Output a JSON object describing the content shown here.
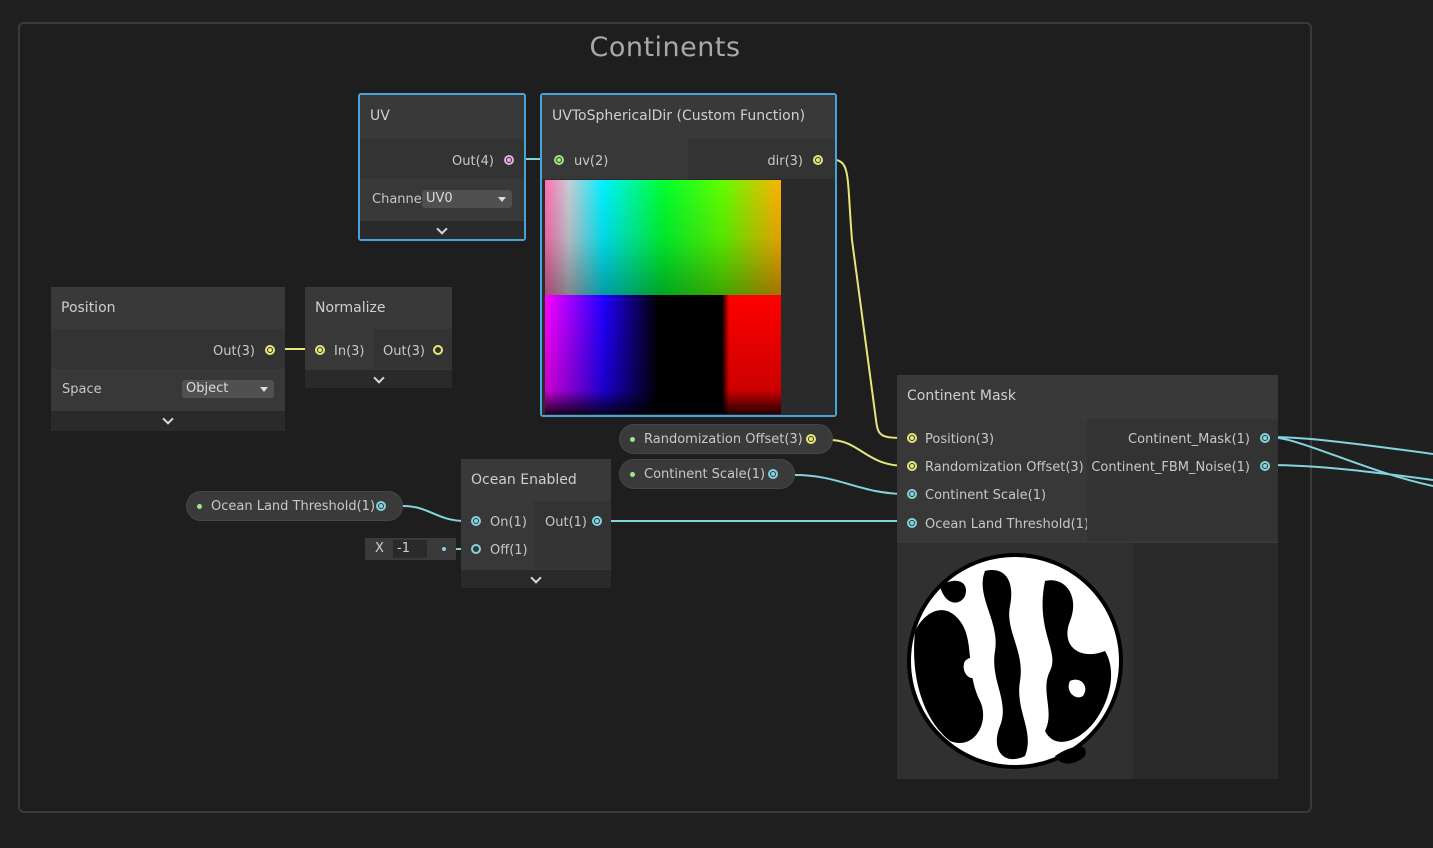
{
  "group": {
    "title": "Continents"
  },
  "nodes": {
    "uv": {
      "title": "UV",
      "out_label": "Out(4)",
      "channel_label": "Channe",
      "channel_value": "UV0"
    },
    "uv_to_spherical": {
      "title": "UVToSphericalDir (Custom Function)",
      "in_label": "uv(2)",
      "out_label": "dir(3)"
    },
    "position": {
      "title": "Position",
      "out_label": "Out(3)",
      "space_label": "Space",
      "space_value": "Object"
    },
    "normalize": {
      "title": "Normalize",
      "in_label": "In(3)",
      "out_label": "Out(3)"
    },
    "ocean_enabled": {
      "title": "Ocean Enabled",
      "in_on": "On(1)",
      "in_off": "Off(1)",
      "out_label": "Out(1)"
    },
    "continent_mask": {
      "title": "Continent Mask",
      "inputs": [
        "Position(3)",
        "Randomization Offset(3)",
        "Continent Scale(1)",
        "Ocean Land Threshold(1)"
      ],
      "outputs": [
        "Continent_Mask(1)",
        "Continent_FBM_Noise(1)"
      ]
    }
  },
  "properties": {
    "randomization_offset": "Randomization Offset(3)",
    "continent_scale": "Continent Scale(1)",
    "ocean_land_threshold": "Ocean Land Threshold(1)"
  },
  "inline_value": {
    "axis": "X",
    "value": "-1"
  },
  "colors": {
    "vector3": "#e6e67a",
    "vector4": "#e7a9e7",
    "float": "#84d4e0",
    "selection": "#4aa3d8"
  }
}
